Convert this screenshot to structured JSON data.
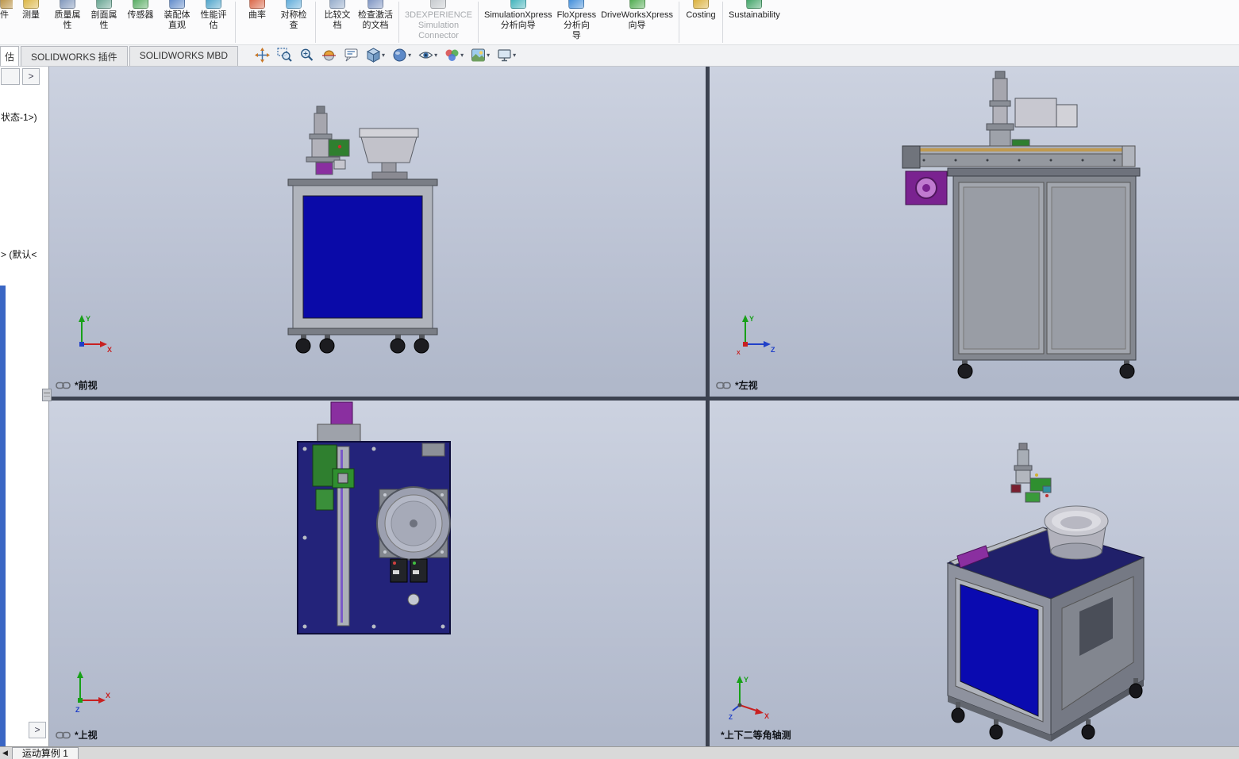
{
  "ribbon": {
    "items": [
      {
        "id": "clipped-tool",
        "label": "件",
        "partial": true,
        "icon_color": "#B89040"
      },
      {
        "id": "measure",
        "label": "测量",
        "icon_color": "#D9B23A"
      },
      {
        "id": "mass-properties",
        "label": "质量属\n性",
        "icon_color": "#7A92B8"
      },
      {
        "id": "section-properties",
        "label": "剖面属\n性",
        "icon_color": "#5FA08C"
      },
      {
        "id": "sensors",
        "label": "传感器",
        "icon_color": "#4FA85A"
      },
      {
        "id": "assembly-visualization",
        "label": "装配体\n直观",
        "icon_color": "#5A86C8"
      },
      {
        "id": "performance-evaluation",
        "label": "性能评\n估",
        "icon_color": "#46A0C8"
      },
      {
        "id": "curvature",
        "label": "曲率",
        "icon_color": "#D86040",
        "sep_before": true
      },
      {
        "id": "symmetry-check",
        "label": "对称检\n查",
        "icon_color": "#58A8D8"
      },
      {
        "id": "compare-documents",
        "label": "比较文\n档",
        "icon_color": "#90A8C8",
        "sep_before": true
      },
      {
        "id": "check-active-document",
        "label": "检查激活\n的文档",
        "icon_color": "#7890C0"
      },
      {
        "id": "3dexperience-simulation-connector",
        "label": "3DEXPERIENCE\nSimulation\nConnector",
        "icon_color": "#C4C8CC",
        "disabled": true,
        "wide": true,
        "sep_before": true
      },
      {
        "id": "simulationxpress-wizard",
        "label": "SimulationXpress\n分析向导",
        "icon_color": "#38B0B8",
        "wide": true,
        "sep_before": true
      },
      {
        "id": "floxpress-wizard",
        "label": "FloXpress\n分析向\n导",
        "icon_color": "#3888D8"
      },
      {
        "id": "driveworksxpress-wizard",
        "label": "DriveWorksXpress\n向导",
        "icon_color": "#48A848",
        "wide": true
      },
      {
        "id": "costing",
        "label": "Costing",
        "icon_color": "#D8AC30",
        "sep_before": true
      },
      {
        "id": "sustainability",
        "label": "Sustainability",
        "icon_color": "#38A060",
        "wide": true,
        "sep_before": true
      }
    ]
  },
  "tabs": [
    {
      "id": "evaluate",
      "label": "估",
      "active": true,
      "partial": true
    },
    {
      "id": "solidworks-addins",
      "label": "SOLIDWORKS 插件"
    },
    {
      "id": "solidworks-mbd",
      "label": "SOLIDWORKS MBD"
    }
  ],
  "view_toolbar": {
    "buttons": [
      {
        "id": "zoom-fit",
        "motif": "axes"
      },
      {
        "id": "zoom-area",
        "motif": "zoom-area"
      },
      {
        "id": "previous-view",
        "motif": "magnifier"
      },
      {
        "id": "section-view",
        "motif": "section"
      },
      {
        "id": "dynamic-annotation-views",
        "motif": "annotation"
      },
      {
        "id": "view-orientation",
        "motif": "cube",
        "caret": true
      },
      {
        "id": "display-style",
        "motif": "sphere",
        "caret": true
      },
      {
        "id": "hide-show-items",
        "motif": "eye",
        "caret": true
      },
      {
        "id": "edit-appearance",
        "motif": "palette",
        "caret": true
      },
      {
        "id": "apply-scene",
        "motif": "scene",
        "caret": true
      },
      {
        "id": "view-settings",
        "motif": "monitor",
        "caret": true
      }
    ]
  },
  "left_panel": {
    "tree_text_1": "状态-1>)",
    "tree_text_2": "> (默认<",
    "expand_arrow": ">",
    "bottom_arrow": ">"
  },
  "viewports": [
    {
      "id": "front",
      "label": "*前视",
      "linked": true,
      "axis_labels": [
        "Y",
        "X"
      ]
    },
    {
      "id": "left",
      "label": "*左视",
      "linked": true,
      "axis_labels": [
        "Y",
        "Z",
        "X"
      ]
    },
    {
      "id": "top",
      "label": "*上视",
      "linked": true,
      "axis_labels": [
        "X",
        "Z"
      ]
    },
    {
      "id": "isometric",
      "label": "*上下二等角轴测",
      "linked": false,
      "axis_labels": [
        "Y",
        "X",
        "Z"
      ]
    }
  ],
  "status_bar": {
    "motion_study_tab": "运动算例 1",
    "collapse_arrow": "◀"
  },
  "colors": {
    "viewport_bg_top": "#CCD2E0",
    "viewport_bg_bottom": "#AFB7C9",
    "panel_blue": "#0A0AA8",
    "deck_navy": "#23237A",
    "machine_gray": "#9EA2AA",
    "pcb_green": "#2F7F2F",
    "feeder_purple": "#8A2FA0",
    "left_strip_blue": "#3A66C4"
  }
}
